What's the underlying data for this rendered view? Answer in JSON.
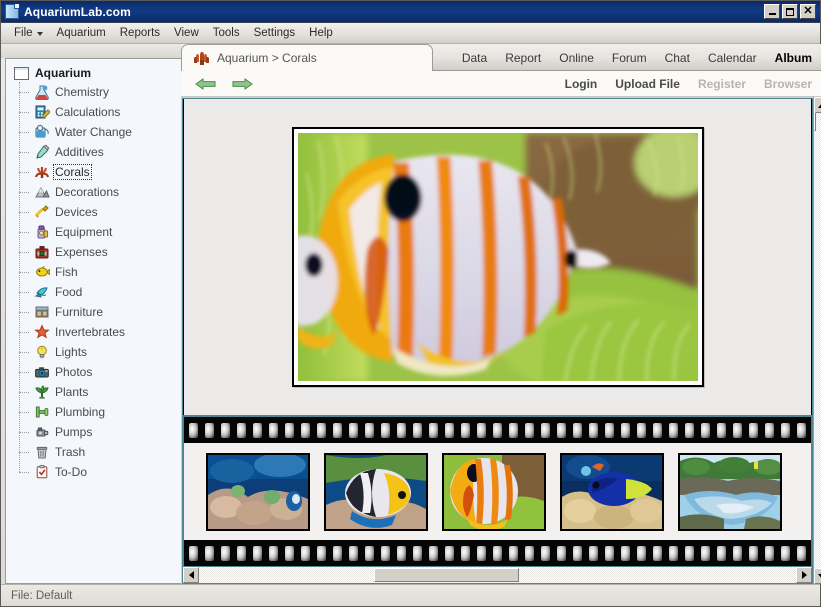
{
  "window": {
    "title": "AquariumLab.com",
    "title_icon": "document-icon",
    "controls": {
      "minimize": "_",
      "maximize": "□",
      "close": "X"
    }
  },
  "menubar": {
    "items": [
      {
        "label": "File",
        "has_dropdown": true
      },
      {
        "label": "Aquarium",
        "has_dropdown": false
      },
      {
        "label": "Reports",
        "has_dropdown": false
      },
      {
        "label": "View",
        "has_dropdown": false
      },
      {
        "label": "Tools",
        "has_dropdown": false
      },
      {
        "label": "Settings",
        "has_dropdown": false
      },
      {
        "label": "Help",
        "has_dropdown": false
      }
    ]
  },
  "sidebar": {
    "root": {
      "label": "Aquarium",
      "icon": "folder-icon"
    },
    "items": [
      {
        "label": "Chemistry",
        "icon": "flask-icon"
      },
      {
        "label": "Calculations",
        "icon": "calculator-icon"
      },
      {
        "label": "Water Change",
        "icon": "water-change-icon"
      },
      {
        "label": "Additives",
        "icon": "dropper-icon"
      },
      {
        "label": "Corals",
        "icon": "coral-icon",
        "selected": true
      },
      {
        "label": "Decorations",
        "icon": "rock-icon"
      },
      {
        "label": "Devices",
        "icon": "plug-icon"
      },
      {
        "label": "Equipment",
        "icon": "equipment-icon"
      },
      {
        "label": "Expenses",
        "icon": "briefcase-icon"
      },
      {
        "label": "Fish",
        "icon": "fish-icon"
      },
      {
        "label": "Food",
        "icon": "food-icon"
      },
      {
        "label": "Furniture",
        "icon": "cabinet-icon"
      },
      {
        "label": "Invertebrates",
        "icon": "starfish-icon"
      },
      {
        "label": "Lights",
        "icon": "bulb-icon"
      },
      {
        "label": "Photos",
        "icon": "camera-icon"
      },
      {
        "label": "Plants",
        "icon": "plant-icon"
      },
      {
        "label": "Plumbing",
        "icon": "pipe-icon"
      },
      {
        "label": "Pumps",
        "icon": "pump-icon"
      },
      {
        "label": "Trash",
        "icon": "trash-icon"
      },
      {
        "label": "To-Do",
        "icon": "checklist-icon"
      }
    ]
  },
  "doctab": {
    "icon": "coral-icon",
    "label": "Aquarium > Corals"
  },
  "toptabs": [
    {
      "label": "Data",
      "active": false
    },
    {
      "label": "Report",
      "active": false
    },
    {
      "label": "Online",
      "active": false
    },
    {
      "label": "Forum",
      "active": false
    },
    {
      "label": "Chat",
      "active": false
    },
    {
      "label": "Calendar",
      "active": false
    },
    {
      "label": "Album",
      "active": true
    }
  ],
  "navigation": {
    "back": {
      "icon": "arrow-left-icon",
      "label": "Back"
    },
    "forward": {
      "icon": "arrow-right-icon",
      "label": "Forward"
    }
  },
  "subactions": [
    {
      "label": "Login",
      "disabled": false,
      "bold": true
    },
    {
      "label": "Upload File",
      "disabled": false,
      "bold": true
    },
    {
      "label": "Register",
      "disabled": true,
      "bold": true
    },
    {
      "label": "Browser",
      "disabled": true,
      "bold": true
    }
  ],
  "album": {
    "main_photo": {
      "name": "copperband-butterflyfish-photo",
      "alt": "Copperband butterflyfish with orange and white vertical stripes among green anemone tentacles"
    },
    "thumbnails": [
      {
        "name": "thumb-coral-reef-tank",
        "alt": "Coral reef aquarium scene with blue water"
      },
      {
        "name": "thumb-butterflyfish",
        "alt": "Black white and yellow butterflyfish"
      },
      {
        "name": "thumb-copperband",
        "alt": "Copperband butterflyfish closeup",
        "selected": true
      },
      {
        "name": "thumb-blue-tang",
        "alt": "Blue tang over coral"
      },
      {
        "name": "thumb-rock-pool",
        "alt": "Outdoor rock pool with sky reflection"
      }
    ],
    "sprocket_count_top": 39,
    "sprocket_count_bottom": 39
  },
  "scrollbars": {
    "vertical": {
      "up": "scroll-up-arrow",
      "down": "scroll-down-arrow"
    },
    "horizontal": {
      "left": "scroll-left-arrow",
      "right": "scroll-right-arrow"
    }
  },
  "statusbar": {
    "text": "File: Default"
  },
  "colors": {
    "titlebar": "#123b86",
    "accent_border": "#4f8494",
    "face": "#d4d0c8",
    "tree_bg": "#f4f8fd",
    "disabled_text": "#b6b4ae"
  }
}
